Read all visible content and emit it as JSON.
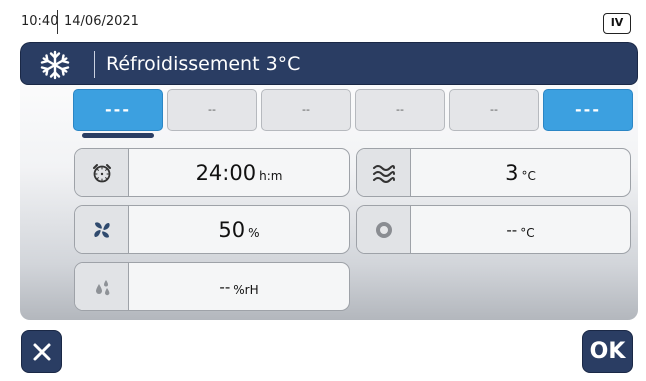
{
  "status": {
    "time": "10:40",
    "date": "14/06/2021",
    "badge": "IV"
  },
  "header": {
    "icon": "snowflake-icon",
    "title": "Réfroidissement 3°C"
  },
  "steps": [
    {
      "label": "---",
      "state": "active",
      "selected": true
    },
    {
      "label": "--",
      "state": "inactive",
      "selected": false
    },
    {
      "label": "--",
      "state": "inactive",
      "selected": false
    },
    {
      "label": "--",
      "state": "inactive",
      "selected": false
    },
    {
      "label": "--",
      "state": "inactive",
      "selected": false
    },
    {
      "label": "---",
      "state": "active",
      "selected": false
    }
  ],
  "tiles": {
    "timer": {
      "icon": "alarm-clock-icon",
      "value": "24:00",
      "unit": "h:m"
    },
    "air_temp": {
      "icon": "air-waves-icon",
      "value": "3",
      "unit": "°C"
    },
    "fan": {
      "icon": "fan-icon",
      "value": "50",
      "unit": "%"
    },
    "probe_temp": {
      "icon": "core-probe-icon",
      "value": "--",
      "unit": "°C"
    },
    "humidity": {
      "icon": "humidity-drops-icon",
      "value": "--",
      "unit": "%rH"
    }
  },
  "buttons": {
    "cancel_icon": "close-icon",
    "ok_label": "OK"
  },
  "colors": {
    "header": "#2a3d63",
    "accent": "#3ca0e0",
    "tile_bg": "#f5f6f7"
  }
}
